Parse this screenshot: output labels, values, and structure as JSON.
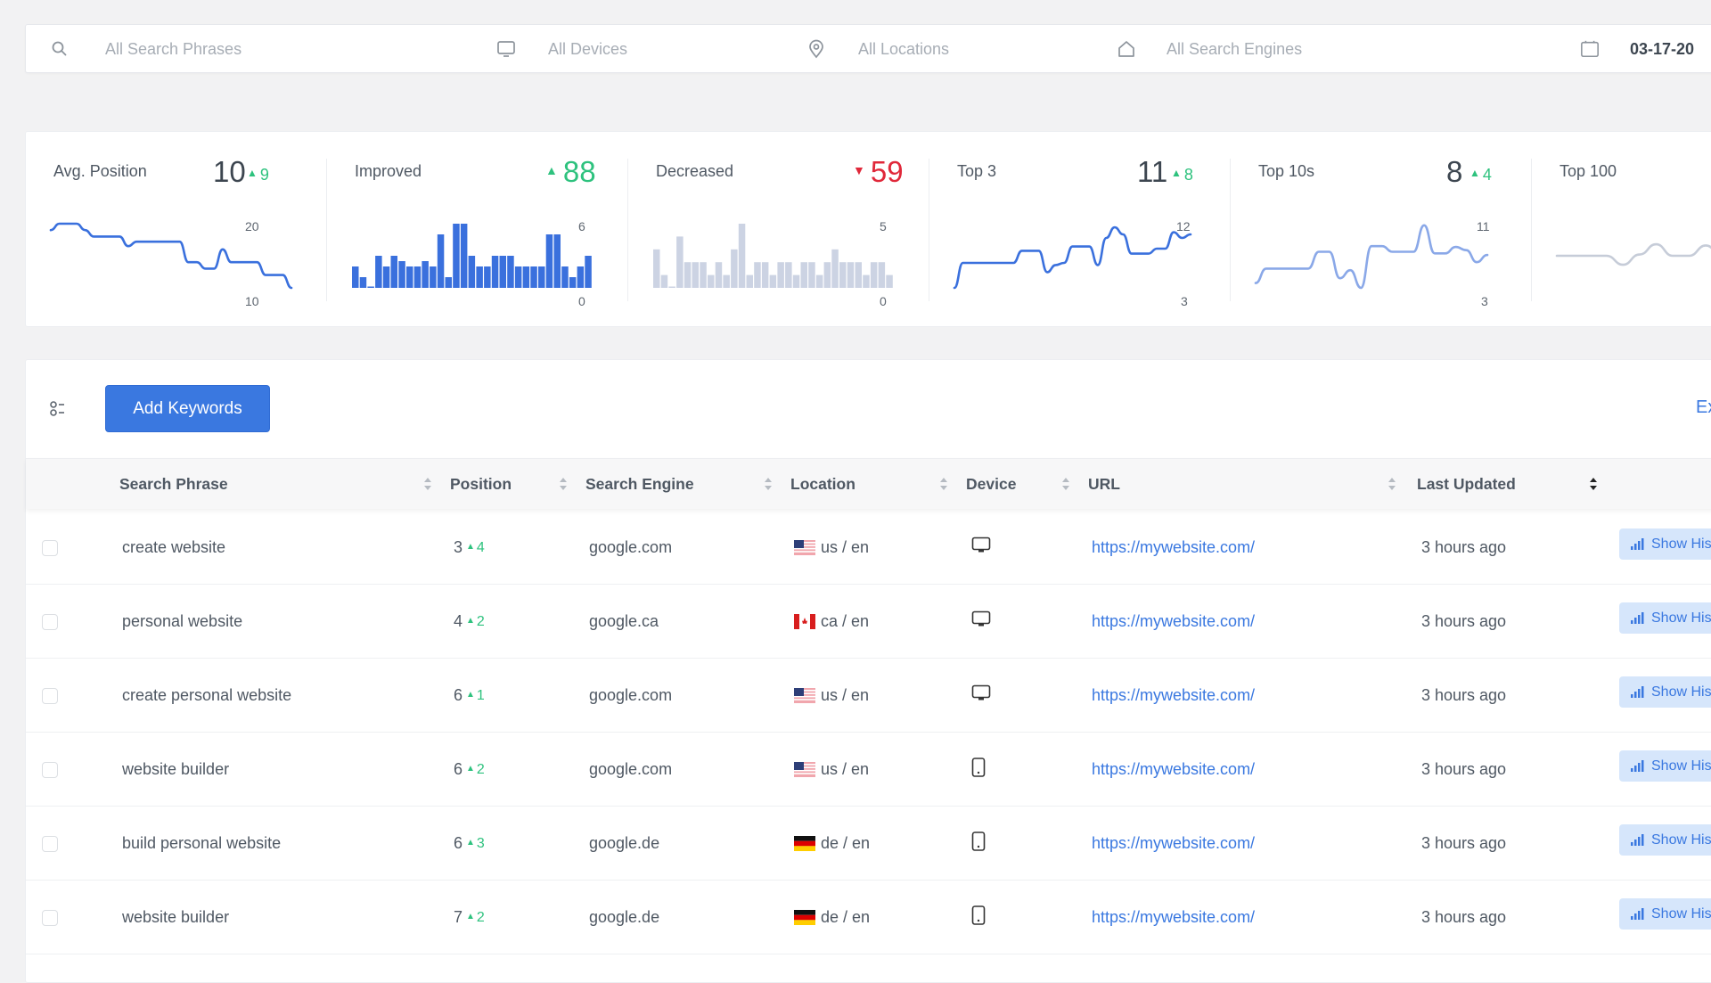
{
  "filters": {
    "search_phrases": "All Search Phrases",
    "devices": "All Devices",
    "locations": "All Locations",
    "search_engines": "All Search Engines",
    "date": "03-17-20",
    "icons": [
      "search-icon",
      "monitor-icon",
      "map-pin-icon",
      "home-icon",
      "calendar-icon"
    ]
  },
  "stats": [
    {
      "title": "Avg. Position",
      "value": "10",
      "delta": "9",
      "delta_dir": "up",
      "axis_max": "20",
      "axis_min": "10"
    },
    {
      "title": "Improved",
      "value": "",
      "delta": "88",
      "delta_dir": "up",
      "axis_max": "6",
      "axis_min": "0"
    },
    {
      "title": "Decreased",
      "value": "",
      "delta": "59",
      "delta_dir": "down",
      "axis_max": "5",
      "axis_min": "0"
    },
    {
      "title": "Top 3",
      "value": "11",
      "delta": "8",
      "delta_dir": "up",
      "axis_max": "12",
      "axis_min": "3"
    },
    {
      "title": "Top 10s",
      "value": "8",
      "delta": "4",
      "delta_dir": "up",
      "axis_max": "11",
      "axis_min": "3"
    },
    {
      "title": "Top 100",
      "value": "",
      "delta": "",
      "delta_dir": "",
      "axis_max": "",
      "axis_min": ""
    }
  ],
  "chart_data": [
    {
      "type": "line",
      "title": "Avg. Position",
      "ylim": [
        10,
        20
      ],
      "color": "#3a70dd",
      "values": [
        19,
        20,
        20,
        20,
        19,
        18,
        18,
        18,
        18,
        16.5,
        17.2,
        17.2,
        17.2,
        17.2,
        17.2,
        17.2,
        14,
        14,
        13,
        13,
        16,
        14,
        14,
        14,
        14,
        12,
        12,
        12,
        10
      ]
    },
    {
      "type": "bar",
      "title": "Improved",
      "ylim": [
        0,
        6
      ],
      "color": "#3a70dd",
      "values": [
        2,
        1,
        0,
        3,
        2,
        3,
        2.5,
        2,
        2,
        2.5,
        2,
        5,
        1,
        6,
        6,
        3,
        2,
        2,
        3,
        3,
        3,
        2,
        2,
        2,
        2,
        5,
        5,
        2,
        1,
        2,
        3
      ]
    },
    {
      "type": "bar",
      "title": "Decreased",
      "ylim": [
        0,
        5
      ],
      "color": "#ccd3e3",
      "values": [
        3,
        1,
        0,
        4,
        2,
        2,
        2,
        1,
        2,
        1,
        3,
        5,
        1,
        2,
        2,
        1,
        2,
        2,
        1,
        2,
        2,
        1,
        2,
        3,
        2,
        2,
        2,
        1,
        2,
        2,
        1
      ]
    },
    {
      "type": "line",
      "title": "Top 3",
      "ylim": [
        3,
        12
      ],
      "color": "#3a70dd",
      "values": [
        3,
        6.5,
        6.5,
        6.5,
        6.5,
        6.5,
        6.5,
        6.5,
        8.2,
        8.2,
        8.2,
        5.2,
        6.2,
        6.5,
        8.8,
        8.8,
        8.8,
        6.2,
        10,
        11.5,
        10.5,
        7.8,
        7.8,
        7.8,
        8.5,
        8.5,
        10.8,
        10,
        10.5
      ]
    },
    {
      "type": "line",
      "title": "Top 10s",
      "ylim": [
        3,
        11
      ],
      "color": "#8aa8e8",
      "values": [
        3.6,
        5.4,
        5.4,
        5.4,
        5.4,
        5.4,
        7.5,
        7.5,
        4.2,
        5.2,
        3,
        8.2,
        8.2,
        7.5,
        7.5,
        7.5,
        10.8,
        7.3,
        7.3,
        8.1,
        7.7,
        6.2,
        7.1
      ]
    },
    {
      "type": "line",
      "title": "Top 100",
      "ylim": [
        0,
        10
      ],
      "color": "#c6ccd8",
      "values": [
        5,
        5,
        5,
        5,
        3.6,
        5.2,
        6.8,
        5,
        5,
        6.6,
        5,
        5,
        5,
        5,
        5
      ]
    }
  ],
  "toolbar": {
    "add_keywords": "Add Keywords",
    "export": "Export"
  },
  "table": {
    "columns": [
      "Search Phrase",
      "Position",
      "Search Engine",
      "Location",
      "Device",
      "URL",
      "Last Updated"
    ],
    "rows": [
      {
        "phrase": "create website",
        "position": "3",
        "position_delta": "4",
        "engine": "google.com",
        "flag": "us",
        "location": "us / en",
        "device": "desktop",
        "url": "https://mywebsite.com/",
        "updated": "3 hours ago",
        "action": "Show History"
      },
      {
        "phrase": "personal website",
        "position": "4",
        "position_delta": "2",
        "engine": "google.ca",
        "flag": "ca",
        "location": "ca / en",
        "device": "desktop",
        "url": "https://mywebsite.com/",
        "updated": "3 hours ago",
        "action": "Show History"
      },
      {
        "phrase": "create personal website",
        "position": "6",
        "position_delta": "1",
        "engine": "google.com",
        "flag": "us",
        "location": "us / en",
        "device": "desktop",
        "url": "https://mywebsite.com/",
        "updated": "3 hours ago",
        "action": "Show History"
      },
      {
        "phrase": "website builder",
        "position": "6",
        "position_delta": "2",
        "engine": "google.com",
        "flag": "us",
        "location": "us / en",
        "device": "mobile",
        "url": "https://mywebsite.com/",
        "updated": "3 hours ago",
        "action": "Show History"
      },
      {
        "phrase": "build personal website",
        "position": "6",
        "position_delta": "3",
        "engine": "google.de",
        "flag": "de",
        "location": "de / en",
        "device": "mobile",
        "url": "https://mywebsite.com/",
        "updated": "3 hours ago",
        "action": "Show History"
      },
      {
        "phrase": "website builder",
        "position": "7",
        "position_delta": "2",
        "engine": "google.de",
        "flag": "de",
        "location": "de / en",
        "device": "mobile",
        "url": "https://mywebsite.com/",
        "updated": "3 hours ago",
        "action": "Show History"
      }
    ]
  },
  "colors": {
    "accent": "#3a78e0",
    "positive": "#2ec27e",
    "negative": "#e0283a",
    "background": "#f2f2f3"
  }
}
